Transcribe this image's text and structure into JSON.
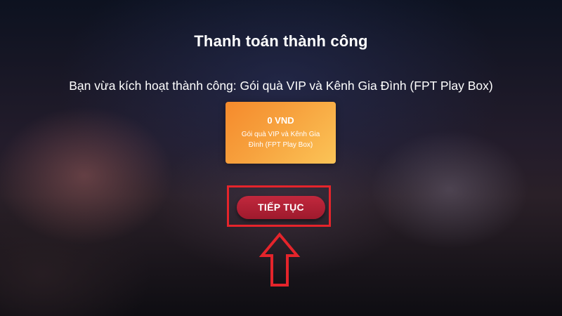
{
  "screen": {
    "title": "Thanh toán thành công",
    "message": "Bạn vừa kích hoạt thành công: Gói quà VIP và Kênh Gia Đình (FPT Play Box)"
  },
  "package": {
    "price": "0 VND",
    "name": "Gói quà VIP và Kênh Gia Đình (FPT Play Box)"
  },
  "actions": {
    "continue_label": "TIẾP TỤC"
  },
  "annotation": {
    "highlight_color": "#e5242b",
    "icon": "up-arrow-icon"
  },
  "colors": {
    "card_gradient_start": "#f58a2c",
    "card_gradient_end": "#fbc457",
    "button": "#b0213a"
  }
}
